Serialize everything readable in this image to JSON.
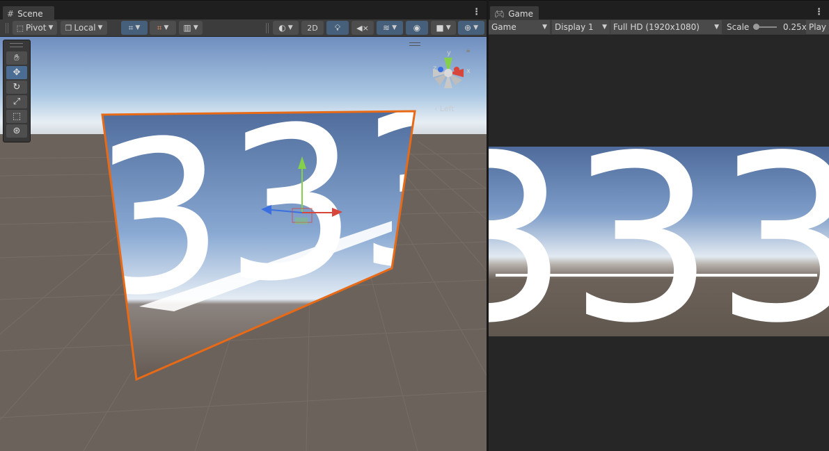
{
  "scene": {
    "tab_title": "Scene",
    "pivot_label": "Pivot",
    "local_label": "Local",
    "mode_2d_label": "2D",
    "gizmo_view_label": "Left",
    "gizmo_axes": {
      "x": "x",
      "y": "y",
      "z": "z"
    },
    "tools": [
      "hand-tool",
      "move-tool",
      "rotate-tool",
      "scale-tool",
      "rect-tool",
      "transform-tool"
    ],
    "active_tool": "move-tool",
    "quad_text": "333"
  },
  "game": {
    "tab_title": "Game",
    "display_mode": "Game",
    "display": "Display 1",
    "resolution": "Full HD (1920x1080)",
    "scale_label": "Scale",
    "scale_value": "0.25x",
    "play_label": "Play",
    "scale_fraction": 0.07
  },
  "colors": {
    "selection_outline": "#e86a17",
    "accent": "#4b6d94",
    "x_axis": "#d8453a",
    "y_axis": "#84d04a",
    "z_axis": "#3a6fe0"
  }
}
